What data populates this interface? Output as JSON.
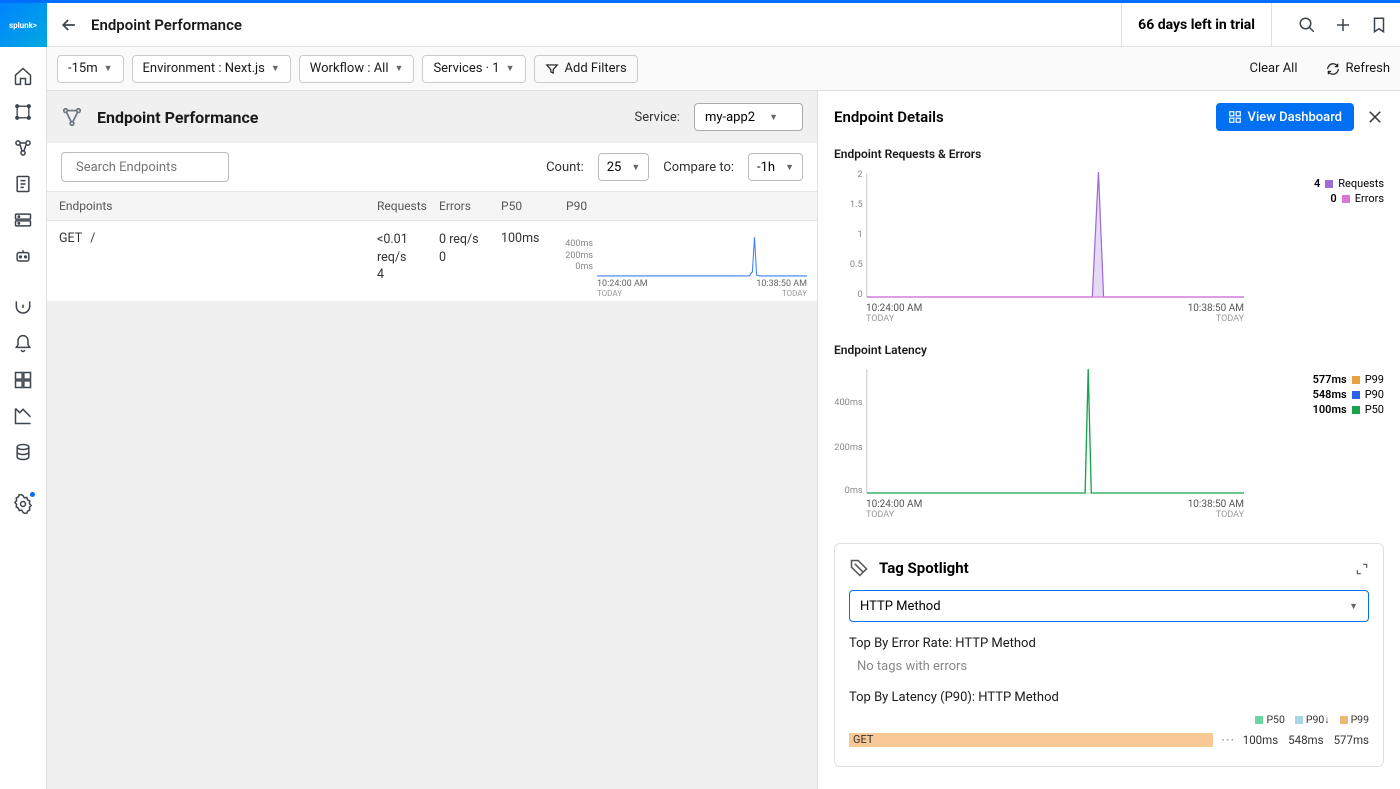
{
  "header": {
    "title": "Endpoint Performance",
    "trial_text": "66 days left in trial"
  },
  "filters": {
    "time": "-15m",
    "env": "Environment : Next.js",
    "workflow": "Workflow : All",
    "services": "Services · 1",
    "add_filters": "Add Filters",
    "clear_all": "Clear All",
    "refresh": "Refresh"
  },
  "ep": {
    "title": "Endpoint Performance",
    "service_label": "Service:",
    "service_value": "my-app2",
    "search_placeholder": "Search Endpoints",
    "count_label": "Count:",
    "count_value": "25",
    "compare_label": "Compare to:",
    "compare_value": "-1h"
  },
  "table": {
    "headers": {
      "ep": "Endpoints",
      "req": "Requests",
      "err": "Errors",
      "p50": "P50",
      "p90": "P90"
    },
    "row": {
      "method": "GET",
      "path": "/",
      "req_line1": "<0.01",
      "req_line2": "req/s",
      "req_line3": "4",
      "err_line1": "0 req/s",
      "err_line2": "0",
      "p50": "100ms",
      "spark_y": [
        "400ms",
        "200ms",
        "0ms"
      ],
      "spark_x1_time": "10:24:00 AM",
      "spark_x1_sub": "TODAY",
      "spark_x2_time": "10:38:50 AM",
      "spark_x2_sub": "TODAY"
    }
  },
  "detail": {
    "title": "Endpoint Details",
    "view_dashboard": "View Dashboard",
    "chart1": {
      "title": "Endpoint Requests & Errors",
      "legend": [
        {
          "val": "4",
          "label": "Requests",
          "color": "#9b6dd7"
        },
        {
          "val": "0",
          "label": "Errors",
          "color": "#d977d9"
        }
      ],
      "yticks": [
        "2",
        "1.5",
        "1",
        "0.5",
        "0"
      ],
      "x1_time": "10:24:00 AM",
      "x1_sub": "TODAY",
      "x2_time": "10:38:50 AM",
      "x2_sub": "TODAY"
    },
    "chart2": {
      "title": "Endpoint Latency",
      "legend": [
        {
          "val": "577ms",
          "label": "P99",
          "color": "#e8a23d"
        },
        {
          "val": "548ms",
          "label": "P90",
          "color": "#2563eb"
        },
        {
          "val": "100ms",
          "label": "P50",
          "color": "#16a34a"
        }
      ],
      "yticks": [
        "400ms",
        "200ms",
        "0ms"
      ],
      "x1_time": "10:24:00 AM",
      "x1_sub": "TODAY",
      "x2_time": "10:38:50 AM",
      "x2_sub": "TODAY"
    },
    "tag": {
      "title": "Tag Spotlight",
      "select_value": "HTTP Method",
      "sub1": "Top By Error Rate: HTTP Method",
      "no_tags": "No tags with errors",
      "sub2": "Top By Latency (P90): HTTP Method",
      "legend": [
        {
          "label": "P50",
          "color": "#6dd6a0"
        },
        {
          "label": "P90↓",
          "color": "#a8d5e8"
        },
        {
          "label": "P99",
          "color": "#f0b878"
        }
      ],
      "bar_label": "GET",
      "bar_vals": [
        "100ms",
        "548ms",
        "577ms"
      ]
    }
  },
  "chart_data": [
    {
      "type": "line",
      "title": "Endpoint Requests & Errors",
      "x_range": [
        "10:24:00",
        "10:38:50"
      ],
      "ylim": [
        0,
        2
      ],
      "series": [
        {
          "name": "Requests",
          "peak_time": "10:35",
          "peak_value": 2,
          "baseline": 0,
          "total": 4
        },
        {
          "name": "Errors",
          "peak_time": null,
          "peak_value": 0,
          "baseline": 0,
          "total": 0
        }
      ]
    },
    {
      "type": "line",
      "title": "Endpoint Latency",
      "x_range": [
        "10:24:00",
        "10:38:50"
      ],
      "ylim": [
        0,
        577
      ],
      "series": [
        {
          "name": "P99",
          "peak_value": 577
        },
        {
          "name": "P90",
          "peak_value": 548
        },
        {
          "name": "P50",
          "peak_value": 100
        }
      ]
    },
    {
      "type": "bar",
      "title": "Top By Latency (P90): HTTP Method",
      "categories": [
        "GET"
      ],
      "series": [
        {
          "name": "P50",
          "values": [
            100
          ]
        },
        {
          "name": "P90",
          "values": [
            548
          ]
        },
        {
          "name": "P99",
          "values": [
            577
          ]
        }
      ]
    }
  ]
}
